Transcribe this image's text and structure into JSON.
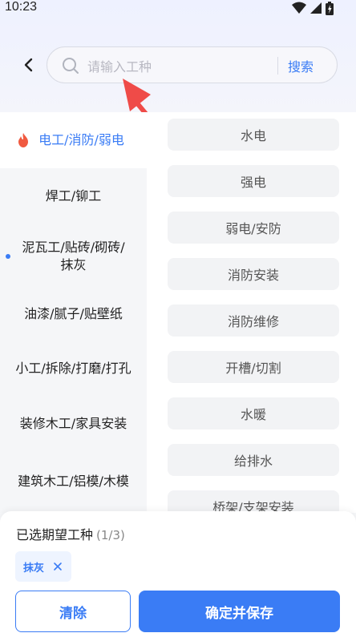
{
  "status_bar": {
    "time": "10:23"
  },
  "search": {
    "placeholder": "请输入工种",
    "value": "",
    "button_label": "搜索"
  },
  "sidebar": {
    "items": [
      {
        "label": "电工/消防/弱电",
        "active": true
      },
      {
        "label": "焊工/铆工"
      },
      {
        "label": "泥瓦工/贴砖/砌砖/\n抹灰",
        "has_dot": true
      },
      {
        "label": "油漆/腻子/贴壁纸"
      },
      {
        "label": "小工/拆除/打磨/打孔"
      },
      {
        "label": "装修木工/家具安装"
      },
      {
        "label": "建筑木工/铝模/木模"
      }
    ]
  },
  "content": {
    "chips": [
      {
        "label": "水电"
      },
      {
        "label": "强电"
      },
      {
        "label": "弱电/安防"
      },
      {
        "label": "消防安装"
      },
      {
        "label": "消防维修"
      },
      {
        "label": "开槽/切割"
      },
      {
        "label": "水暖"
      },
      {
        "label": "给排水"
      },
      {
        "label": "桥架/支架安装"
      }
    ]
  },
  "selection": {
    "title": "已选期望工种",
    "count": "(1/3)",
    "tags": [
      {
        "label": "抹灰"
      }
    ]
  },
  "actions": {
    "clear_label": "清除",
    "save_label": "确定并保存"
  },
  "colors": {
    "accent": "#3a7cf5",
    "annotation_arrow": "#ef4b48",
    "flame": "#f05a40"
  }
}
